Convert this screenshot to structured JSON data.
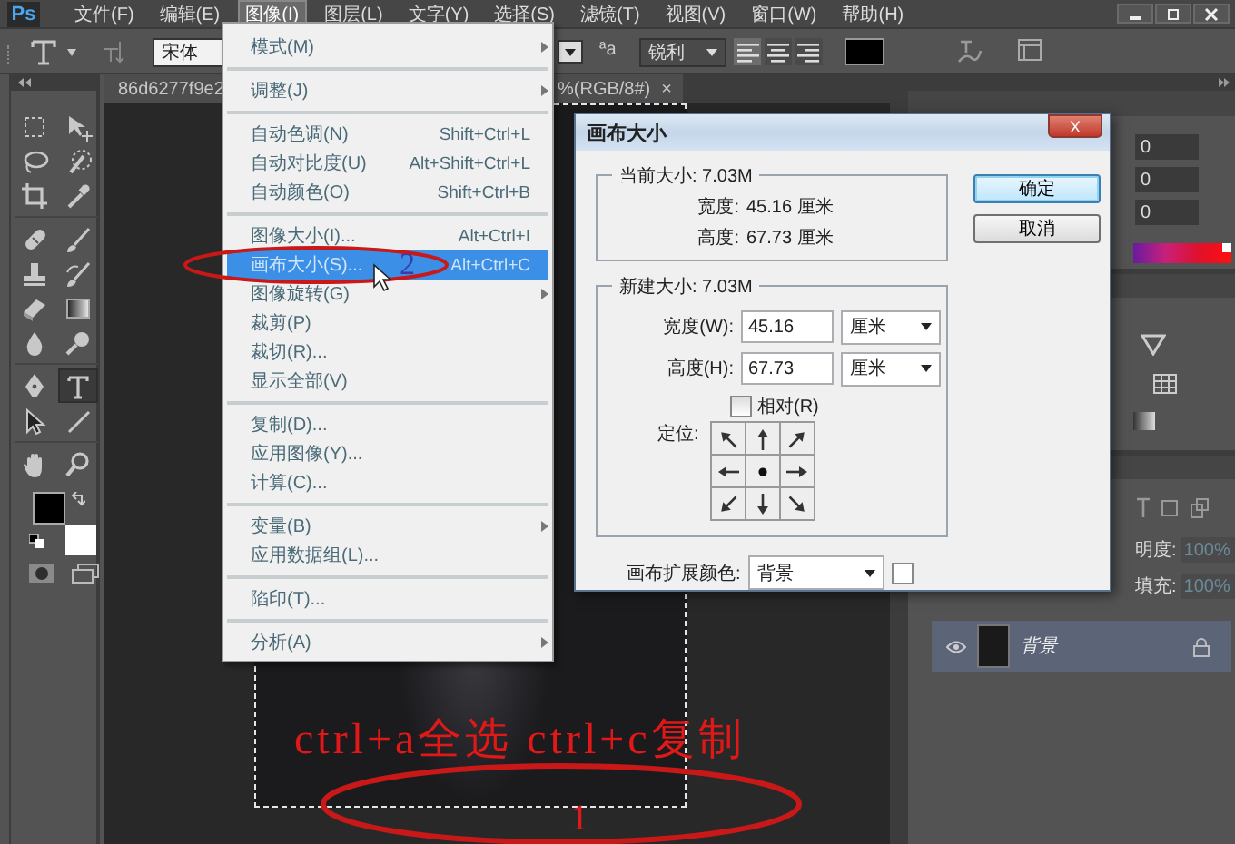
{
  "app_logo": "Ps",
  "menu_bar": {
    "items": [
      {
        "label": "文件(F)",
        "selected": false
      },
      {
        "label": "编辑(E)",
        "selected": false
      },
      {
        "label": "图像(I)",
        "selected": true
      },
      {
        "label": "图层(L)",
        "selected": false
      },
      {
        "label": "文字(Y)",
        "selected": false
      },
      {
        "label": "选择(S)",
        "selected": false
      },
      {
        "label": "滤镜(T)",
        "selected": false
      },
      {
        "label": "视图(V)",
        "selected": false
      },
      {
        "label": "窗口(W)",
        "selected": false
      },
      {
        "label": "帮助(H)",
        "selected": false
      }
    ]
  },
  "options_bar": {
    "font_family": "宋体",
    "anti_alias_glyph": "ªa",
    "anti_alias": "锐利"
  },
  "document_tab": {
    "title_start": "86d6277f9e2",
    "title_end": "%(RGB/8#)",
    "close": "×"
  },
  "tools": [
    {
      "selected": false
    },
    {
      "selected": false
    },
    {
      "selected": false
    },
    {
      "selected": false
    },
    {
      "selected": false
    },
    {
      "selected": false
    },
    {
      "selected": false
    },
    {
      "selected": false
    },
    {
      "selected": false
    },
    {
      "selected": false
    },
    {
      "selected": false
    },
    {
      "selected": false
    },
    {
      "selected": false
    },
    {
      "selected": false
    },
    {
      "selected": false
    },
    {
      "selected": true
    },
    {
      "selected": false
    },
    {
      "selected": false
    },
    {
      "selected": false
    },
    {
      "selected": false
    }
  ],
  "image_menu": {
    "items": [
      {
        "kind": "item",
        "label": "模式(M)",
        "submenu": true,
        "selected": false
      },
      {
        "kind": "separator"
      },
      {
        "kind": "item",
        "label": "调整(J)",
        "submenu": true,
        "selected": false
      },
      {
        "kind": "separator"
      },
      {
        "kind": "item",
        "label": "自动色调(N)",
        "shortcut": "Shift+Ctrl+L",
        "selected": false
      },
      {
        "kind": "item",
        "label": "自动对比度(U)",
        "shortcut": "Alt+Shift+Ctrl+L",
        "selected": false
      },
      {
        "kind": "item",
        "label": "自动颜色(O)",
        "shortcut": "Shift+Ctrl+B",
        "selected": false
      },
      {
        "kind": "separator"
      },
      {
        "kind": "item",
        "label": "图像大小(I)...",
        "shortcut": "Alt+Ctrl+I",
        "selected": false
      },
      {
        "kind": "item",
        "label": "画布大小(S)...",
        "shortcut": "Alt+Ctrl+C",
        "selected": true
      },
      {
        "kind": "item",
        "label": "图像旋转(G)",
        "submenu": true,
        "selected": false
      },
      {
        "kind": "item",
        "label": "裁剪(P)",
        "selected": false
      },
      {
        "kind": "item",
        "label": "裁切(R)...",
        "selected": false
      },
      {
        "kind": "item",
        "label": "显示全部(V)",
        "selected": false
      },
      {
        "kind": "separator"
      },
      {
        "kind": "item",
        "label": "复制(D)...",
        "selected": false
      },
      {
        "kind": "item",
        "label": "应用图像(Y)...",
        "selected": false
      },
      {
        "kind": "item",
        "label": "计算(C)...",
        "selected": false
      },
      {
        "kind": "separator"
      },
      {
        "kind": "item",
        "label": "变量(B)",
        "submenu": true,
        "selected": false
      },
      {
        "kind": "item",
        "label": "应用数据组(L)...",
        "selected": false
      },
      {
        "kind": "separator"
      },
      {
        "kind": "item",
        "label": "陷印(T)...",
        "selected": false
      },
      {
        "kind": "separator"
      },
      {
        "kind": "item",
        "label": "分析(A)",
        "submenu": true,
        "selected": false
      }
    ]
  },
  "dialog": {
    "title": "画布大小",
    "close": "X",
    "current_size": {
      "legend": "当前大小: 7.03M",
      "rows": [
        {
          "label": "宽度:",
          "value": "45.16 厘米"
        },
        {
          "label": "高度:",
          "value": "67.73 厘米"
        }
      ]
    },
    "new_size": {
      "legend": "新建大小: 7.03M",
      "fields": [
        {
          "label": "宽度(W):",
          "value": "45.16",
          "unit": "厘米"
        },
        {
          "label": "高度(H):",
          "value": "67.73",
          "unit": "厘米"
        }
      ]
    },
    "relative": {
      "label": "相对(R)",
      "checked": false
    },
    "anchor_label": "定位:",
    "anchor_cells": [
      {
        "selected": false
      },
      {
        "selected": false
      },
      {
        "selected": false
      },
      {
        "selected": false
      },
      {
        "selected": true
      },
      {
        "selected": false
      },
      {
        "selected": false
      },
      {
        "selected": false
      },
      {
        "selected": false
      }
    ],
    "extension_color": {
      "label": "画布扩展颜色:",
      "value": "背景"
    },
    "buttons": [
      {
        "label": "确定",
        "default": true
      },
      {
        "label": "取消",
        "default": false
      }
    ]
  },
  "color_panel": {
    "values": [
      "0",
      "0",
      "0"
    ]
  },
  "layers_panel": {
    "opacity_label": "明度:",
    "opacity": "100%",
    "fill_label": "填充:",
    "fill": "100%",
    "layers": [
      {
        "name": "背景",
        "visible": true,
        "locked": true,
        "selected": true
      }
    ]
  },
  "annotations": {
    "caption": "ctrl+a全选 ctrl+c复制",
    "menu_marker": "2",
    "canvas_marker": "1"
  }
}
